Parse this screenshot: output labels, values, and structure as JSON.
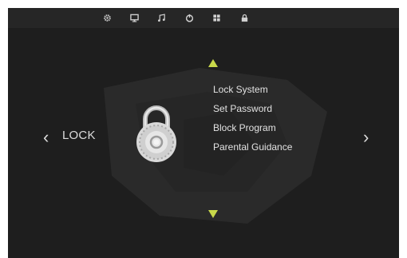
{
  "tabs": [
    {
      "icon": "gear-icon"
    },
    {
      "icon": "monitor-icon"
    },
    {
      "icon": "music-icon"
    },
    {
      "icon": "power-icon"
    },
    {
      "icon": "grid-icon"
    },
    {
      "icon": "lock-icon",
      "selected": true
    }
  ],
  "section": {
    "title": "LOCK"
  },
  "menu": {
    "items": [
      "Lock System",
      "Set Password",
      "Block Program",
      "Parental Guidance"
    ]
  },
  "colors": {
    "accent": "#c8d84a",
    "background": "#1e1e1e",
    "text": "#e2e2e2"
  }
}
